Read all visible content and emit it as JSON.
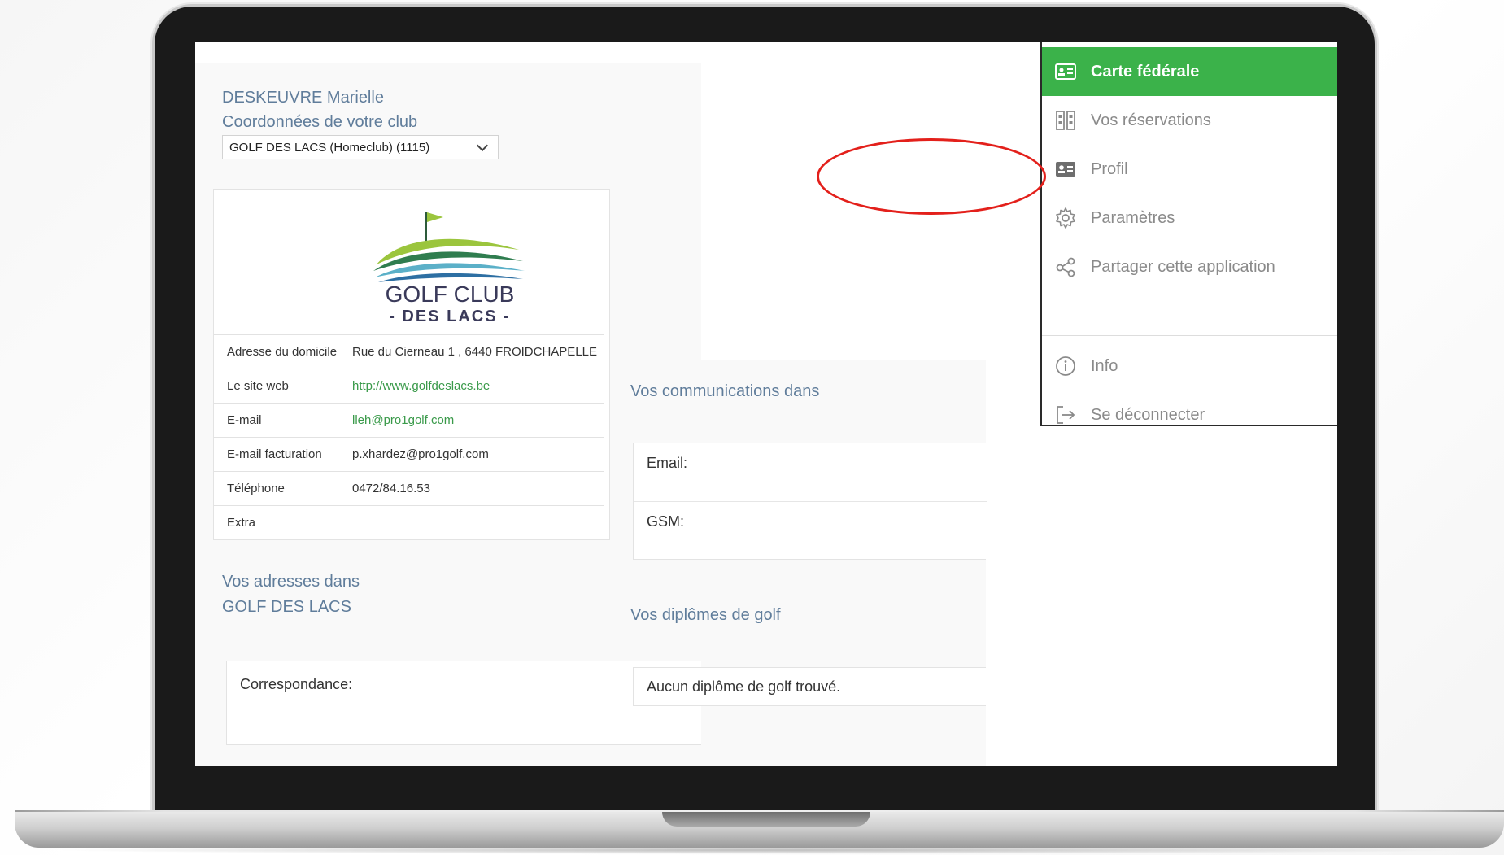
{
  "user": {
    "name": "DESKEUVRE Marielle"
  },
  "club": {
    "heading": "Coordonnées de votre club",
    "selected": "GOLF DES LACS (Homeclub) (1115)",
    "logo": {
      "line1": "GOLF CLUB",
      "line2": "- DES LACS -"
    },
    "info": [
      {
        "label": "Adresse du domicile",
        "value": "Rue du Cierneau 1 , 6440 FROIDCHAPELLE"
      },
      {
        "label": "Le site web",
        "value": "http://www.golfdeslacs.be"
      },
      {
        "label": "E-mail",
        "value": "lleh@pro1golf.com"
      },
      {
        "label": "E-mail facturation",
        "value": "p.xhardez@pro1golf.com"
      },
      {
        "label": "Téléphone",
        "value": "0472/84.16.53"
      },
      {
        "label": "Extra",
        "value": ""
      }
    ]
  },
  "addresses": {
    "heading_line1": "Vos adresses dans",
    "heading_line2": "GOLF DES LACS",
    "correspondance_label": "Correspondance:"
  },
  "communications": {
    "heading": "Vos communications dans",
    "email_label": "Email:",
    "gsm_label": "GSM:"
  },
  "diplomas": {
    "heading": "Vos diplômes de golf",
    "empty_text": "Aucun diplôme de golf trouvé."
  },
  "menu": {
    "items": [
      {
        "label": "Carte fédérale",
        "icon": "id-card-icon"
      },
      {
        "label": "Vos réservations",
        "icon": "reservations-icon"
      },
      {
        "label": "Profil",
        "icon": "profile-card-icon"
      },
      {
        "label": "Paramètres",
        "icon": "gear-icon"
      },
      {
        "label": "Partager cette application",
        "icon": "share-icon"
      },
      {
        "label": "Info",
        "icon": "info-icon"
      },
      {
        "label": "Se déconnecter",
        "icon": "logout-icon"
      }
    ],
    "active_color": "#3bb24a"
  },
  "colors": {
    "heading": "#607d9b",
    "link": "#3a9a4a",
    "highlight": "#e3201b"
  }
}
